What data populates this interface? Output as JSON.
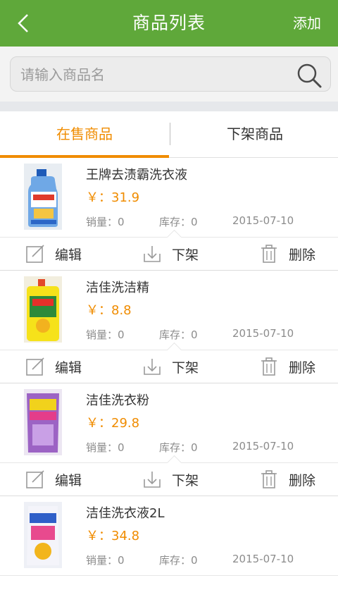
{
  "header": {
    "title": "商品列表",
    "add_label": "添加"
  },
  "search": {
    "placeholder": "请输入商品名"
  },
  "tabs": [
    {
      "label": "在售商品",
      "active": true
    },
    {
      "label": "下架商品",
      "active": false
    }
  ],
  "labels": {
    "sales": "销量",
    "stock": "库存",
    "currency": "￥："
  },
  "actions": {
    "edit": "编辑",
    "offshelf": "下架",
    "delete": "删除"
  },
  "products": [
    {
      "name": "王牌去渍霸洗衣液",
      "price_display": "￥：31.9",
      "sales_display": "销量：0",
      "stock_display": "库存：0",
      "date": "2015-07-10"
    },
    {
      "name": "洁佳洗洁精",
      "price_display": "￥：8.8",
      "sales_display": "销量：0",
      "stock_display": "库存：0",
      "date": "2015-07-10"
    },
    {
      "name": "洁佳洗衣粉",
      "price_display": "￥：29.8",
      "sales_display": "销量：0",
      "stock_display": "库存：0",
      "date": "2015-07-10"
    },
    {
      "name": "洁佳洗衣液2L",
      "price_display": "￥：34.8",
      "sales_display": "销量：0",
      "stock_display": "库存：0",
      "date": "2015-07-10"
    }
  ],
  "colors": {
    "header_bg": "#5fa83a",
    "accent": "#f08c00"
  }
}
